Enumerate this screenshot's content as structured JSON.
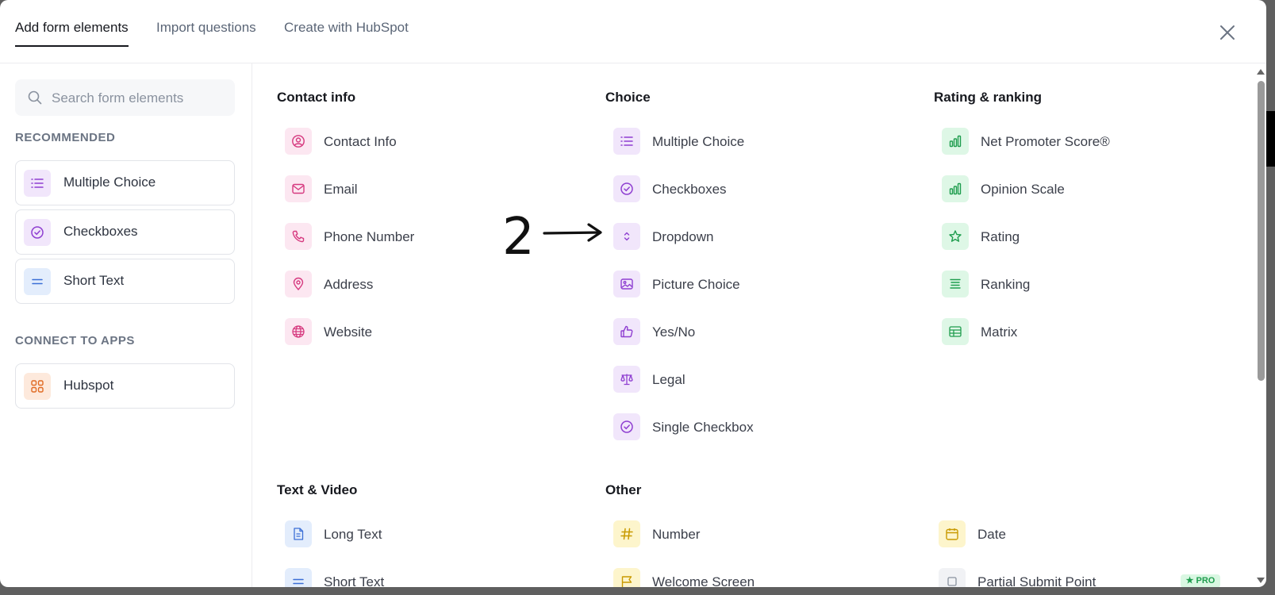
{
  "tabs": [
    {
      "label": "Add form elements"
    },
    {
      "label": "Import questions"
    },
    {
      "label": "Create with HubSpot"
    }
  ],
  "search": {
    "placeholder": "Search form elements"
  },
  "sidebar": {
    "recommended_heading": "RECOMMENDED",
    "recommended": [
      {
        "label": "Multiple Choice",
        "icon": "list-icon"
      },
      {
        "label": "Checkboxes",
        "icon": "check-circle-icon"
      },
      {
        "label": "Short Text",
        "icon": "short-text-icon"
      }
    ],
    "apps_heading": "CONNECT TO APPS",
    "apps": [
      {
        "label": "Hubspot",
        "icon": "grid-icon"
      }
    ]
  },
  "sections": {
    "contact": {
      "title": "Contact info",
      "items": [
        {
          "label": "Contact Info",
          "icon": "user-circle-icon"
        },
        {
          "label": "Email",
          "icon": "mail-icon"
        },
        {
          "label": "Phone Number",
          "icon": "phone-icon"
        },
        {
          "label": "Address",
          "icon": "map-pin-icon"
        },
        {
          "label": "Website",
          "icon": "globe-icon"
        }
      ]
    },
    "choice": {
      "title": "Choice",
      "items": [
        {
          "label": "Multiple Choice",
          "icon": "list-icon"
        },
        {
          "label": "Checkboxes",
          "icon": "check-circle-icon"
        },
        {
          "label": "Dropdown",
          "icon": "chevron-updown-icon"
        },
        {
          "label": "Picture Choice",
          "icon": "image-icon"
        },
        {
          "label": "Yes/No",
          "icon": "thumbs-up-icon"
        },
        {
          "label": "Legal",
          "icon": "scales-icon"
        },
        {
          "label": "Single Checkbox",
          "icon": "check-circle-icon"
        }
      ]
    },
    "rating": {
      "title": "Rating & ranking",
      "items": [
        {
          "label": "Net Promoter Score®",
          "icon": "bar-chart-icon"
        },
        {
          "label": "Opinion Scale",
          "icon": "bar-chart-icon"
        },
        {
          "label": "Rating",
          "icon": "star-icon"
        },
        {
          "label": "Ranking",
          "icon": "ranking-icon"
        },
        {
          "label": "Matrix",
          "icon": "table-icon"
        }
      ]
    },
    "text_video": {
      "title": "Text & Video",
      "items": [
        {
          "label": "Long Text",
          "icon": "document-icon"
        },
        {
          "label": "Short Text",
          "icon": "short-text-icon"
        }
      ]
    },
    "other": {
      "title": "Other",
      "items": [
        {
          "label": "Number",
          "icon": "hash-icon"
        },
        {
          "label": "Welcome Screen",
          "icon": "flag-icon"
        },
        {
          "label": "Date",
          "icon": "calendar-icon"
        },
        {
          "label": "Partial Submit Point",
          "icon": "square-icon",
          "badge": "★ PRO"
        }
      ]
    }
  },
  "annotation": {
    "number": "2",
    "target": "Dropdown"
  },
  "colors": {
    "pink": "#d6397f",
    "purple": "#8f3fd1",
    "blue": "#3b6fd6",
    "green": "#1f9d4e",
    "yellow": "#c99a00",
    "orange": "#e06a23"
  }
}
